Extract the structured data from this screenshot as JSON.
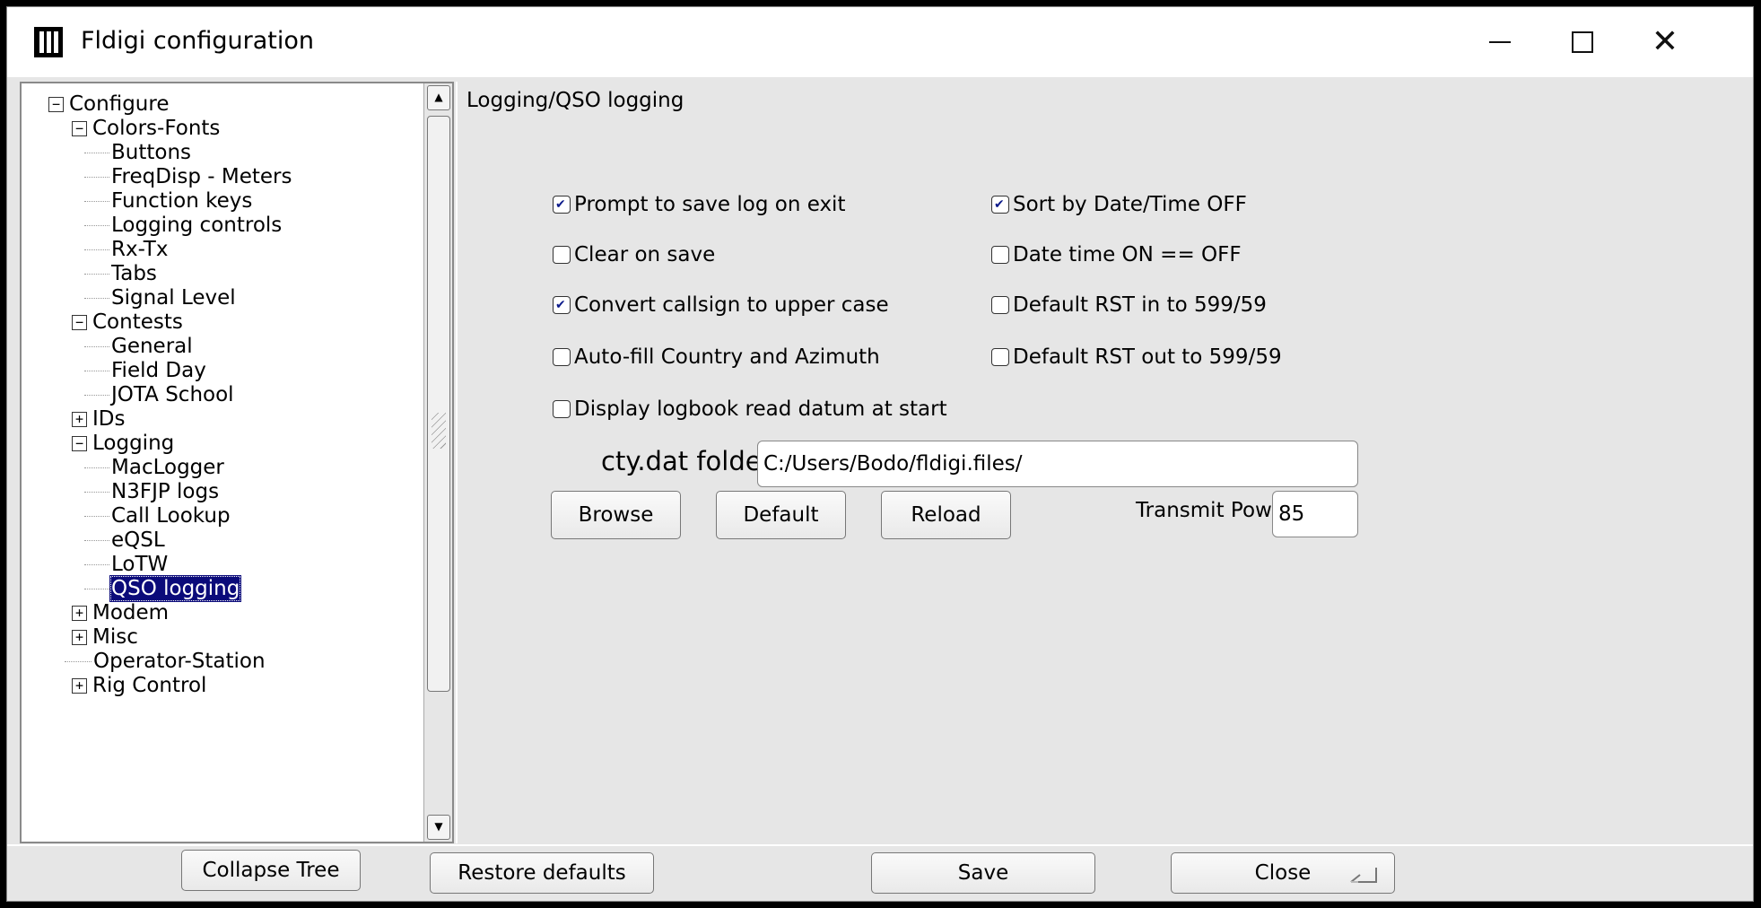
{
  "window": {
    "title": "Fldigi configuration",
    "controls": {
      "minimize_icon": "minimize-icon",
      "maximize_icon": "maximize-icon",
      "close_icon": "close-icon"
    }
  },
  "tree": {
    "items": [
      {
        "label": "Configure",
        "level": 0,
        "toggle": "−"
      },
      {
        "label": "Colors-Fonts",
        "level": 1,
        "toggle": "−"
      },
      {
        "label": "Buttons",
        "level": 2
      },
      {
        "label": "FreqDisp - Meters",
        "level": 2
      },
      {
        "label": "Function keys",
        "level": 2
      },
      {
        "label": "Logging controls",
        "level": 2
      },
      {
        "label": "Rx-Tx",
        "level": 2
      },
      {
        "label": "Tabs",
        "level": 2
      },
      {
        "label": "Signal Level",
        "level": 2
      },
      {
        "label": "Contests",
        "level": 1,
        "toggle": "−"
      },
      {
        "label": "General",
        "level": 2
      },
      {
        "label": "Field Day",
        "level": 2
      },
      {
        "label": "JOTA School",
        "level": 2
      },
      {
        "label": "IDs",
        "level": 1,
        "toggle": "+"
      },
      {
        "label": "Logging",
        "level": 1,
        "toggle": "−"
      },
      {
        "label": "MacLogger",
        "level": 2
      },
      {
        "label": "N3FJP logs",
        "level": 2
      },
      {
        "label": "Call Lookup",
        "level": 2
      },
      {
        "label": "eQSL",
        "level": 2
      },
      {
        "label": "LoTW",
        "level": 2
      },
      {
        "label": "QSO logging",
        "level": 2,
        "selected": true
      },
      {
        "label": "Modem",
        "level": 1,
        "toggle": "+"
      },
      {
        "label": "Misc",
        "level": 1,
        "toggle": "+"
      },
      {
        "label": "Operator-Station",
        "level": 1
      },
      {
        "label": "Rig Control",
        "level": 1,
        "toggle": "+"
      }
    ]
  },
  "panel": {
    "title": "Logging/QSO logging",
    "checkboxes": [
      {
        "label": "Prompt to save log on exit",
        "checked": true
      },
      {
        "label": "Sort by Date/Time OFF",
        "checked": true
      },
      {
        "label": "Clear on save",
        "checked": false
      },
      {
        "label": "Date time ON == OFF",
        "checked": false
      },
      {
        "label": "Convert callsign to upper case",
        "checked": true
      },
      {
        "label": "Default RST in to 599/59",
        "checked": false
      },
      {
        "label": "Auto-fill Country and Azimuth",
        "checked": false
      },
      {
        "label": "Default RST out to 599/59",
        "checked": false
      },
      {
        "label": "Display logbook read datum at start",
        "checked": false
      }
    ],
    "cty_label": "cty.dat folder",
    "cty_value": "C:/Users/Bodo/fldigi.files/",
    "browse_label": "Browse",
    "default_label": "Default",
    "reload_label": "Reload",
    "tx_power_label": "Transmit Power",
    "tx_power_value": "85"
  },
  "footer": {
    "collapse_label": "Collapse Tree",
    "restore_label": "Restore defaults",
    "save_label": "Save",
    "close_label": "Close",
    "return_icon": "return-key-icon"
  }
}
